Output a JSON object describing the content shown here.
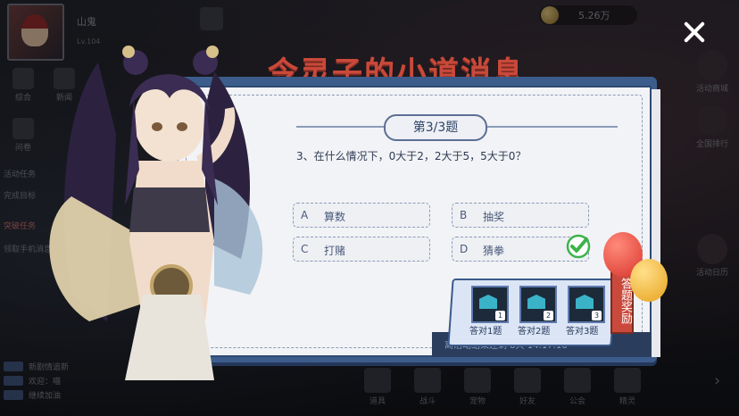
{
  "hud": {
    "player_name": "山鬼",
    "player_level": "Lv.104",
    "currency_value": "5.26万",
    "left_menu": [
      "综合",
      "新闻",
      "问卷"
    ],
    "side_texts": [
      "活动任务",
      "完成目标",
      "突破任务",
      "领取手机消息"
    ],
    "right_menu": [
      "活动商城",
      "全国排行",
      "活动日历"
    ],
    "bottom_menu": [
      "道具",
      "战斗",
      "宠物",
      "好友",
      "公会",
      "精灵"
    ],
    "chat_lines": [
      "新剧情追新",
      "欢迎：喵",
      "继续加油"
    ]
  },
  "quiz": {
    "banner_title": "令灵子的小道消息",
    "question_number": "第3/3题",
    "question_text": "3、在什么情况下，0大于2，2大于5，5大于0？",
    "options": [
      {
        "letter": "A",
        "text": "算数"
      },
      {
        "letter": "B",
        "text": "抽奖"
      },
      {
        "letter": "C",
        "text": "打赌"
      },
      {
        "letter": "D",
        "text": "猜拳"
      }
    ],
    "correct_option": "D",
    "footer_text": "离活动结束还剩 8天 14:17:16",
    "reward_tag": "答题奖励",
    "rewards": [
      {
        "num": "1",
        "label": "答对1题"
      },
      {
        "num": "2",
        "label": "答对2题"
      },
      {
        "num": "3",
        "label": "答对3题"
      }
    ]
  },
  "colors": {
    "board_blue": "#3c5d8c",
    "title_red": "#c9493a",
    "check_green": "#3db34a"
  }
}
